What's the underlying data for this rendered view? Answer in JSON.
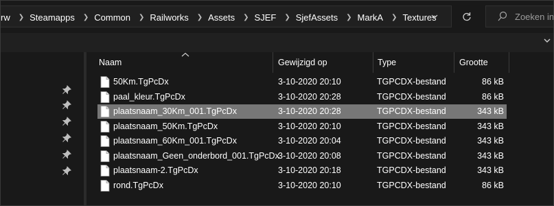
{
  "breadcrumbs": [
    "rw",
    "Steamapps",
    "Common",
    "Railworks",
    "Assets",
    "SJEF",
    "SjefAssets",
    "MarkA",
    "Textures"
  ],
  "search": {
    "placeholder": "Zoeken in"
  },
  "columns": {
    "name": "Naam",
    "modified": "Gewijzigd op",
    "type": "Type",
    "size": "Grootte"
  },
  "files": [
    {
      "name": "50Km.TgPcDx",
      "modified": "3-10-2020 20:10",
      "type": "TGPCDX-bestand",
      "size": "86 kB"
    },
    {
      "name": "paal_kleur.TgPcDx",
      "modified": "3-10-2020 20:28",
      "type": "TGPCDX-bestand",
      "size": "86 kB"
    },
    {
      "name": "plaatsnaam_30Km_001.TgPcDx",
      "modified": "3-10-2020 20:28",
      "type": "TGPCDX-bestand",
      "size": "343 kB",
      "selected": true
    },
    {
      "name": "plaatsnaam_50Km.TgPcDx",
      "modified": "3-10-2020 20:10",
      "type": "TGPCDX-bestand",
      "size": "343 kB"
    },
    {
      "name": "plaatsnaam_60Km_001.TgPcDx",
      "modified": "3-10-2020 20:04",
      "type": "TGPCDX-bestand",
      "size": "343 kB"
    },
    {
      "name": "plaatsnaam_Geen_onderbord_001.TgPcDx",
      "modified": "3-10-2020 20:08",
      "type": "TGPCDX-bestand",
      "size": "343 kB"
    },
    {
      "name": "plaatsnaam-2.TgPcDx",
      "modified": "3-10-2020 20:18",
      "type": "TGPCDX-bestand",
      "size": "343 kB"
    },
    {
      "name": "rond.TgPcDx",
      "modified": "3-10-2020 20:10",
      "type": "TGPCDX-bestand",
      "size": "86 kB"
    }
  ],
  "colors": {
    "background": "#191919",
    "selected_row": "#777777",
    "text": "#ffffff",
    "muted": "#9b9b9b"
  },
  "icons": [
    "chevron-right-icon",
    "chevron-down-icon",
    "refresh-icon",
    "search-icon",
    "pin-icon",
    "file-icon",
    "sort-up-icon"
  ]
}
